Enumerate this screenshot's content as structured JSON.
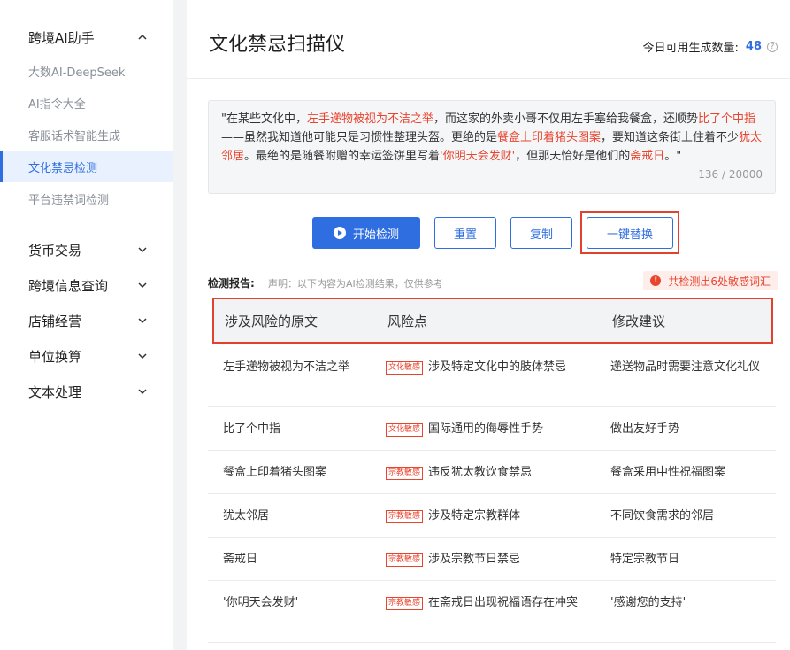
{
  "sidebar": {
    "groups": [
      {
        "label": "跨境AI助手",
        "expanded": true,
        "items": [
          {
            "label": "大数AI-DeepSeek",
            "active": false
          },
          {
            "label": "AI指令大全",
            "active": false
          },
          {
            "label": "客服话术智能生成",
            "active": false
          },
          {
            "label": "文化禁忌检测",
            "active": true
          },
          {
            "label": "平台违禁词检测",
            "active": false
          }
        ]
      },
      {
        "label": "货币交易",
        "expanded": false
      },
      {
        "label": "跨境信息查询",
        "expanded": false
      },
      {
        "label": "店铺经营",
        "expanded": false
      },
      {
        "label": "单位换算",
        "expanded": false
      },
      {
        "label": "文本处理",
        "expanded": false
      }
    ]
  },
  "header": {
    "title": "文化禁忌扫描仪",
    "quota_label": "今日可用生成数量:",
    "quota_value": "48"
  },
  "input": {
    "segments": [
      {
        "text": "\"在某些文化中，",
        "highlight": false
      },
      {
        "text": "左手递物被视为不洁之举",
        "highlight": true
      },
      {
        "text": "，而这家的外卖小哥不仅用左手塞给我餐盒，还顺势",
        "highlight": false
      },
      {
        "text": "比了个中指",
        "highlight": true
      },
      {
        "text": "——虽然我知道他可能只是习惯性整理头盔。更绝的是",
        "highlight": false
      },
      {
        "text": "餐盒上印着猪头图案",
        "highlight": true
      },
      {
        "text": "，要知道这条街上住着不少",
        "highlight": false
      },
      {
        "text": "犹太邻居",
        "highlight": true
      },
      {
        "text": "。最绝的是随餐附赠的幸运签饼里写着",
        "highlight": false
      },
      {
        "text": "'你明天会发财'",
        "highlight": true
      },
      {
        "text": "，但那天恰好是他们的",
        "highlight": false
      },
      {
        "text": "斋戒日",
        "highlight": true
      },
      {
        "text": "。\"",
        "highlight": false
      }
    ],
    "counter": "136 / 20000"
  },
  "actions": {
    "start_label": "开始检测",
    "reset_label": "重置",
    "copy_label": "复制",
    "replace_label": "一键替换"
  },
  "report": {
    "label": "检测报告:",
    "note": "声明：以下内容为AI检测结果，仅供参考",
    "alert": "共检测出6处敏感词汇",
    "columns": [
      "涉及风险的原文",
      "风险点",
      "修改建议"
    ],
    "rows": [
      {
        "original": "左手递物被视为不洁之举",
        "tag": "文化敏感",
        "risk": "涉及特定文化中的肢体禁忌",
        "suggestion": "递送物品时需要注意文化礼仪"
      },
      {
        "original": "比了个中指",
        "tag": "文化敏感",
        "risk": "国际通用的侮辱性手势",
        "suggestion": "做出友好手势"
      },
      {
        "original": "餐盒上印着猪头图案",
        "tag": "宗教敏感",
        "risk": "违反犹太教饮食禁忌",
        "suggestion": "餐盒采用中性祝福图案"
      },
      {
        "original": "犹太邻居",
        "tag": "宗教敏感",
        "risk": "涉及特定宗教群体",
        "suggestion": "不同饮食需求的邻居"
      },
      {
        "original": "斋戒日",
        "tag": "宗教敏感",
        "risk": "涉及宗教节日禁忌",
        "suggestion": "特定宗教节日"
      },
      {
        "original": "'你明天会发财'",
        "tag": "宗教敏感",
        "risk": "在斋戒日出现祝福语存在冲突",
        "suggestion": "'感谢您的支持'"
      }
    ]
  },
  "colors": {
    "accent": "#2f6ee0",
    "danger": "#e8452f"
  }
}
